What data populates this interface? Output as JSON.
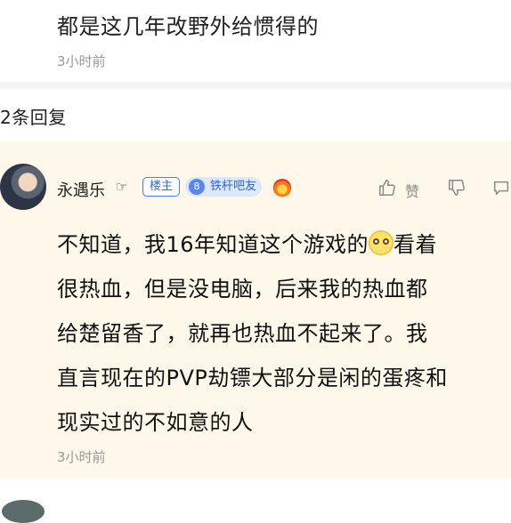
{
  "previous_reply": {
    "text": "都是这几年改野外给惯得的",
    "time": "3小时前"
  },
  "reply_count_label": "2条回复",
  "comment": {
    "username": "永遇乐",
    "owner_badge": "楼主",
    "level_number": "8",
    "level_name": "铁杆吧友",
    "like_label": "赞",
    "lines": [
      {
        "before": "不知道，我16年知道这个游戏的",
        "after": "看着"
      },
      {
        "text": "很热血，但是没电脑，后来我的热血都"
      },
      {
        "text": "给楚留香了，就再也热血不起来了。我"
      },
      {
        "text": "直言现在的PVP劫镖大部分是闲的蛋疼和"
      },
      {
        "text": "现实过的不如意的人"
      }
    ],
    "time": "3小时前"
  },
  "icons": {
    "hand": "hand-pointing-icon",
    "flame": "flame-badge-icon",
    "like": "thumbs-up-icon",
    "dislike": "thumbs-down-icon",
    "more": "comment-icon",
    "emoji": "grinning-face-emoji"
  },
  "colors": {
    "highlight_bg": "#fdf8ea",
    "badge_blue": "#3569e8",
    "muted_text": "#999999"
  }
}
